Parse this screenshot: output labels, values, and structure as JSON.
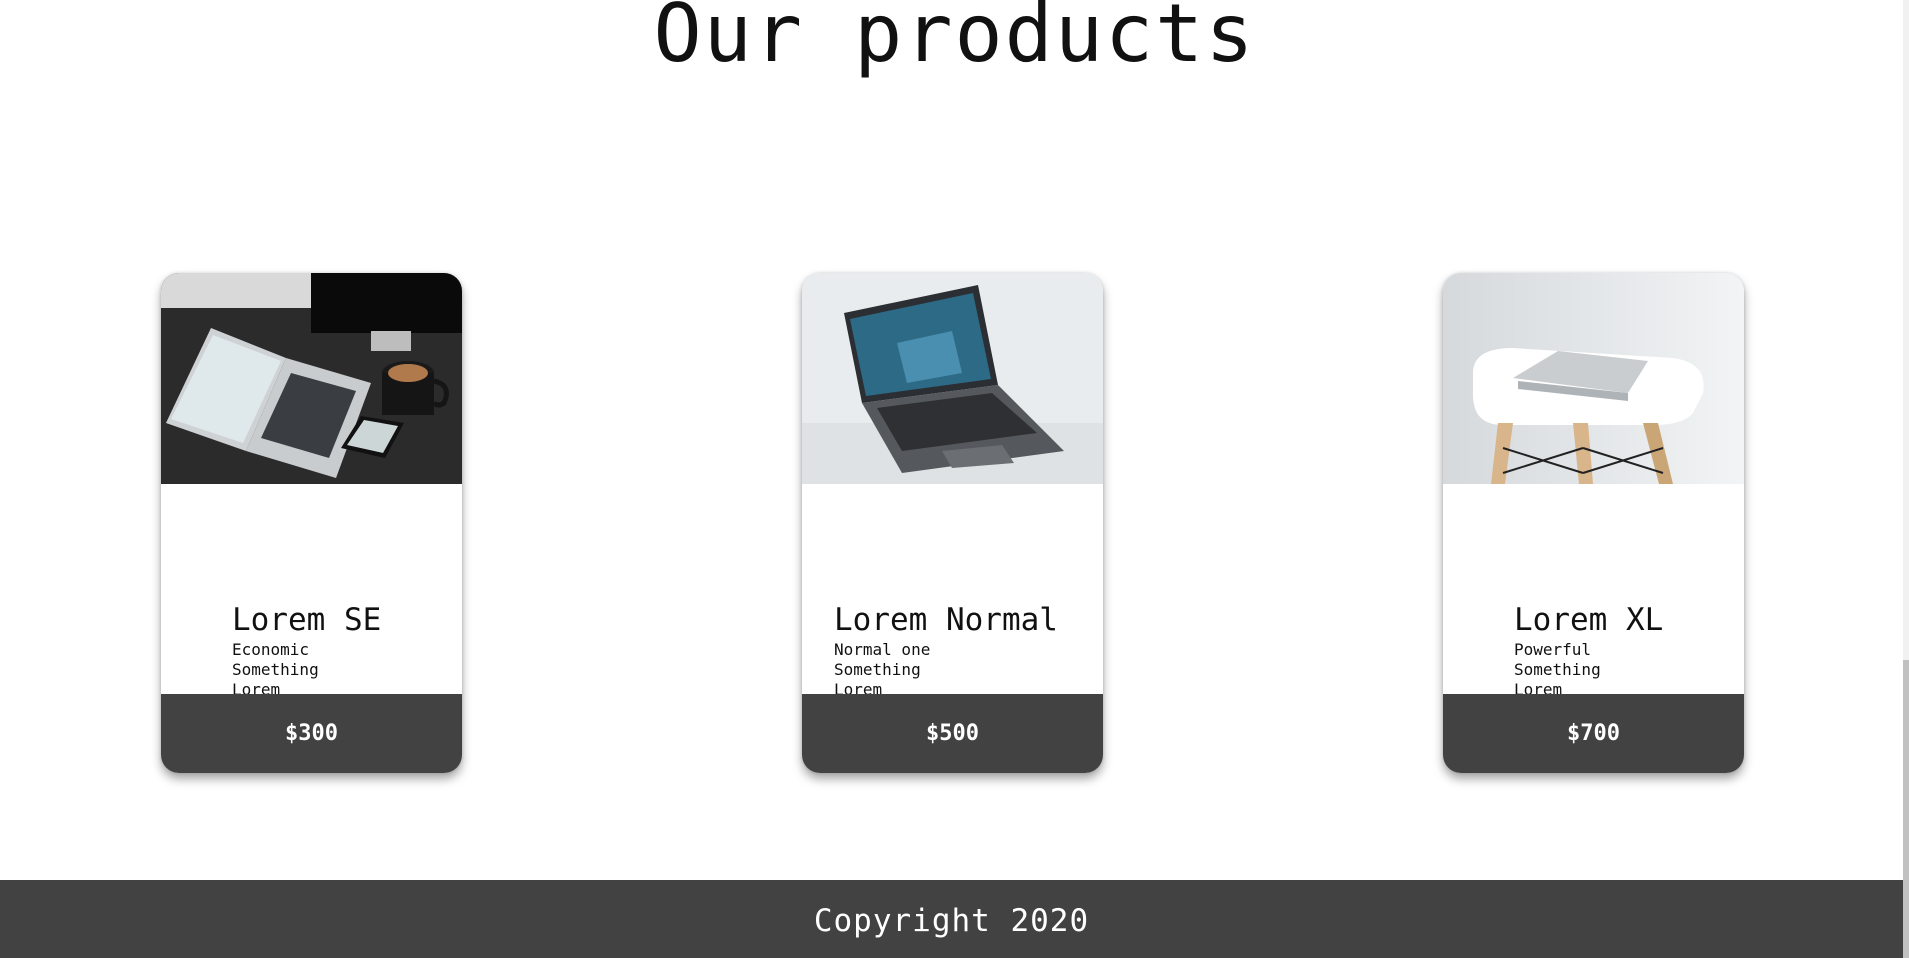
{
  "page": {
    "heading": "Our products",
    "footer_text": "Copyright 2020"
  },
  "products": [
    {
      "name": "Lorem SE",
      "desc": [
        "Economic",
        "Something",
        "Lorem"
      ],
      "price": "$300",
      "image_subject": "laptop-on-desk-with-coffee-photo"
    },
    {
      "name": "Lorem Normal",
      "desc": [
        "Normal one",
        "Something",
        "Lorem"
      ],
      "price": "$500",
      "image_subject": "open-laptop-photo"
    },
    {
      "name": "Lorem XL",
      "desc": [
        "Powerful",
        "Something",
        "Lorem"
      ],
      "price": "$700",
      "image_subject": "laptop-on-white-chair-photo"
    }
  ],
  "colors": {
    "dark_bar": "#424242",
    "background": "#ffffff",
    "text": "#111111"
  }
}
